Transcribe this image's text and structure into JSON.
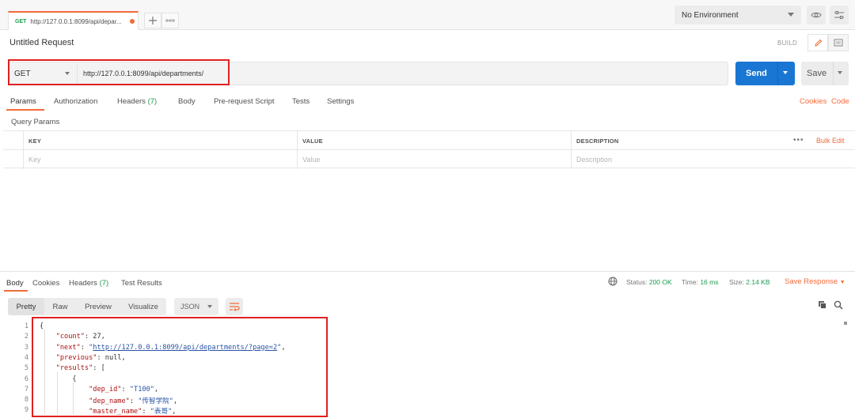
{
  "tab": {
    "method": "GET",
    "url": "http://127.0.0.1:8099/api/depar..."
  },
  "environment": {
    "selected": "No Environment"
  },
  "request": {
    "name": "Untitled Request",
    "build_label": "BUILD",
    "method": "GET",
    "url": "http://127.0.0.1:8099/api/departments/",
    "send_label": "Send",
    "save_label": "Save"
  },
  "request_tabs": {
    "params": "Params",
    "authorization": "Authorization",
    "headers": "Headers",
    "headers_count": "(7)",
    "body": "Body",
    "prerequest": "Pre-request Script",
    "tests": "Tests",
    "settings": "Settings",
    "cookies": "Cookies",
    "code": "Code"
  },
  "query_params": {
    "title": "Query Params",
    "headers": [
      "KEY",
      "VALUE",
      "DESCRIPTION"
    ],
    "placeholders": [
      "Key",
      "Value",
      "Description"
    ],
    "more": "•••",
    "bulk_edit": "Bulk Edit"
  },
  "response_tabs": {
    "body": "Body",
    "cookies": "Cookies",
    "headers": "Headers",
    "headers_count": "(7)",
    "test_results": "Test Results"
  },
  "status": {
    "status_label": "Status:",
    "status_value": "200 OK",
    "time_label": "Time:",
    "time_value": "16 ms",
    "size_label": "Size:",
    "size_value": "2.14 KB",
    "save_response": "Save Response"
  },
  "view": {
    "buttons": [
      "Pretty",
      "Raw",
      "Preview",
      "Visualize"
    ],
    "format": "JSON"
  },
  "code": {
    "lines": [
      {
        "n": "1",
        "indent": "",
        "parts": [
          {
            "t": "{",
            "c": "n"
          }
        ]
      },
      {
        "n": "2",
        "indent": "    ",
        "parts": [
          {
            "t": "\"count\"",
            "c": "k"
          },
          {
            "t": ": 27,",
            "c": "n"
          }
        ]
      },
      {
        "n": "3",
        "indent": "    ",
        "parts": [
          {
            "t": "\"next\"",
            "c": "k"
          },
          {
            "t": ": ",
            "c": "n"
          },
          {
            "t": "\"",
            "c": "s"
          },
          {
            "t": "http://127.0.0.1:8099/api/departments/?page=2",
            "c": "lnk"
          },
          {
            "t": "\"",
            "c": "s"
          },
          {
            "t": ",",
            "c": "n"
          }
        ]
      },
      {
        "n": "4",
        "indent": "    ",
        "parts": [
          {
            "t": "\"previous\"",
            "c": "k"
          },
          {
            "t": ": null,",
            "c": "n"
          }
        ]
      },
      {
        "n": "5",
        "indent": "    ",
        "parts": [
          {
            "t": "\"results\"",
            "c": "k"
          },
          {
            "t": ": [",
            "c": "n"
          }
        ]
      },
      {
        "n": "6",
        "indent": "        ",
        "parts": [
          {
            "t": "{",
            "c": "n"
          }
        ]
      },
      {
        "n": "7",
        "indent": "            ",
        "parts": [
          {
            "t": "\"dep_id\"",
            "c": "k"
          },
          {
            "t": ": ",
            "c": "n"
          },
          {
            "t": "\"T100\"",
            "c": "s"
          },
          {
            "t": ",",
            "c": "n"
          }
        ]
      },
      {
        "n": "8",
        "indent": "            ",
        "parts": [
          {
            "t": "\"dep_name\"",
            "c": "k"
          },
          {
            "t": ": ",
            "c": "n"
          },
          {
            "t": "\"传智学院\"",
            "c": "s"
          },
          {
            "t": ",",
            "c": "n"
          }
        ]
      },
      {
        "n": "9",
        "indent": "            ",
        "parts": [
          {
            "t": "\"master_name\"",
            "c": "k"
          },
          {
            "t": ": ",
            "c": "n"
          },
          {
            "t": "\"表哥\"",
            "c": "s"
          },
          {
            "t": ",",
            "c": "n"
          }
        ]
      }
    ]
  }
}
